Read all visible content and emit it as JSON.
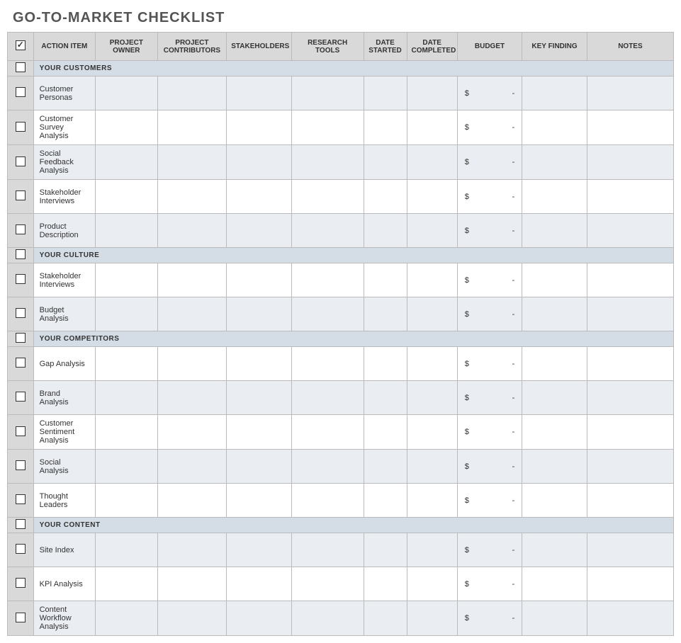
{
  "title": "GO-TO-MARKET CHECKLIST",
  "headers": {
    "check": "",
    "action": "ACTION ITEM",
    "owner": "PROJECT OWNER",
    "contrib": "PROJECT CONTRIBUTORS",
    "stake": "STAKEHOLDERS",
    "research": "RESEARCH TOOLS",
    "dstart": "DATE STARTED",
    "dcomp": "DATE COMPLETED",
    "budget": "BUDGET",
    "key": "KEY FINDING",
    "notes": "NOTES"
  },
  "budget_symbol": "$",
  "budget_dash": "-",
  "sections": [
    {
      "label": "YOUR CUSTOMERS",
      "rows": [
        {
          "action": "Customer Personas",
          "alt": true
        },
        {
          "action": "Customer Survey Analysis",
          "alt": false
        },
        {
          "action": "Social Feedback Analysis",
          "alt": true
        },
        {
          "action": "Stakeholder Interviews",
          "alt": false
        },
        {
          "action": "Product Description",
          "alt": true
        }
      ]
    },
    {
      "label": "YOUR CULTURE",
      "rows": [
        {
          "action": "Stakeholder Interviews",
          "alt": false
        },
        {
          "action": "Budget Analysis",
          "alt": true
        }
      ]
    },
    {
      "label": "YOUR COMPETITORS",
      "rows": [
        {
          "action": "Gap Analysis",
          "alt": false
        },
        {
          "action": "Brand Analysis",
          "alt": true
        },
        {
          "action": "Customer Sentiment Analysis",
          "alt": false
        },
        {
          "action": "Social Analysis",
          "alt": true
        },
        {
          "action": "Thought Leaders",
          "alt": false
        }
      ]
    },
    {
      "label": "YOUR CONTENT",
      "rows": [
        {
          "action": "Site Index",
          "alt": true
        },
        {
          "action": "KPI Analysis",
          "alt": false
        },
        {
          "action": "Content Workflow Analysis",
          "alt": true
        }
      ]
    }
  ]
}
